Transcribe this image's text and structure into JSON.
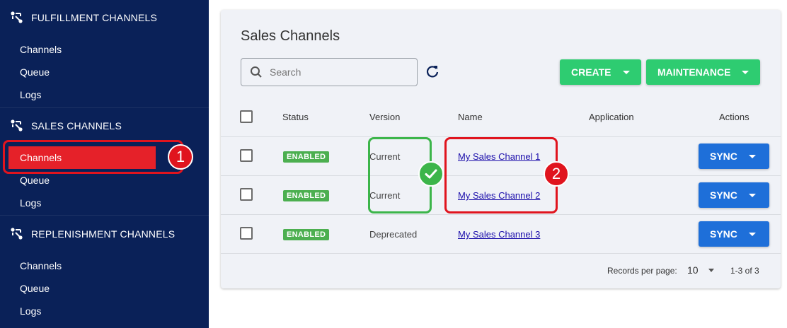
{
  "sidebar": {
    "sections": [
      {
        "title": "FULFILLMENT CHANNELS",
        "items": [
          "Channels",
          "Queue",
          "Logs"
        ]
      },
      {
        "title": "SALES CHANNELS",
        "items": [
          "Channels",
          "Queue",
          "Logs"
        ]
      },
      {
        "title": "REPLENISHMENT CHANNELS",
        "items": [
          "Channels",
          "Queue",
          "Logs"
        ]
      }
    ],
    "active_item": "SALES CHANNELS > Channels",
    "colors": {
      "background": "#0a2158",
      "active": "#e52129"
    }
  },
  "callouts": {
    "one": "1",
    "two": "2"
  },
  "main": {
    "title": "Sales Channels",
    "search": {
      "placeholder": "Search"
    },
    "buttons": {
      "create": "CREATE",
      "maintenance": "MAINTENANCE"
    },
    "table": {
      "headers": {
        "status": "Status",
        "version": "Version",
        "name": "Name",
        "application": "Application",
        "actions": "Actions"
      },
      "rows": [
        {
          "status": "ENABLED",
          "version": "Current",
          "name": "My Sales Channel 1",
          "application": "",
          "action": "SYNC"
        },
        {
          "status": "ENABLED",
          "version": "Current",
          "name": "My Sales Channel 2",
          "application": "",
          "action": "SYNC"
        },
        {
          "status": "ENABLED",
          "version": "Deprecated",
          "name": "My Sales Channel 3",
          "application": "",
          "action": "SYNC"
        }
      ]
    },
    "footer": {
      "records_label": "Records per page:",
      "records_value": "10",
      "range": "1-3 of 3"
    },
    "colors": {
      "green_button": "#2ecc71",
      "sync_button": "#1e6fd9",
      "status_badge": "#4caf50"
    }
  }
}
